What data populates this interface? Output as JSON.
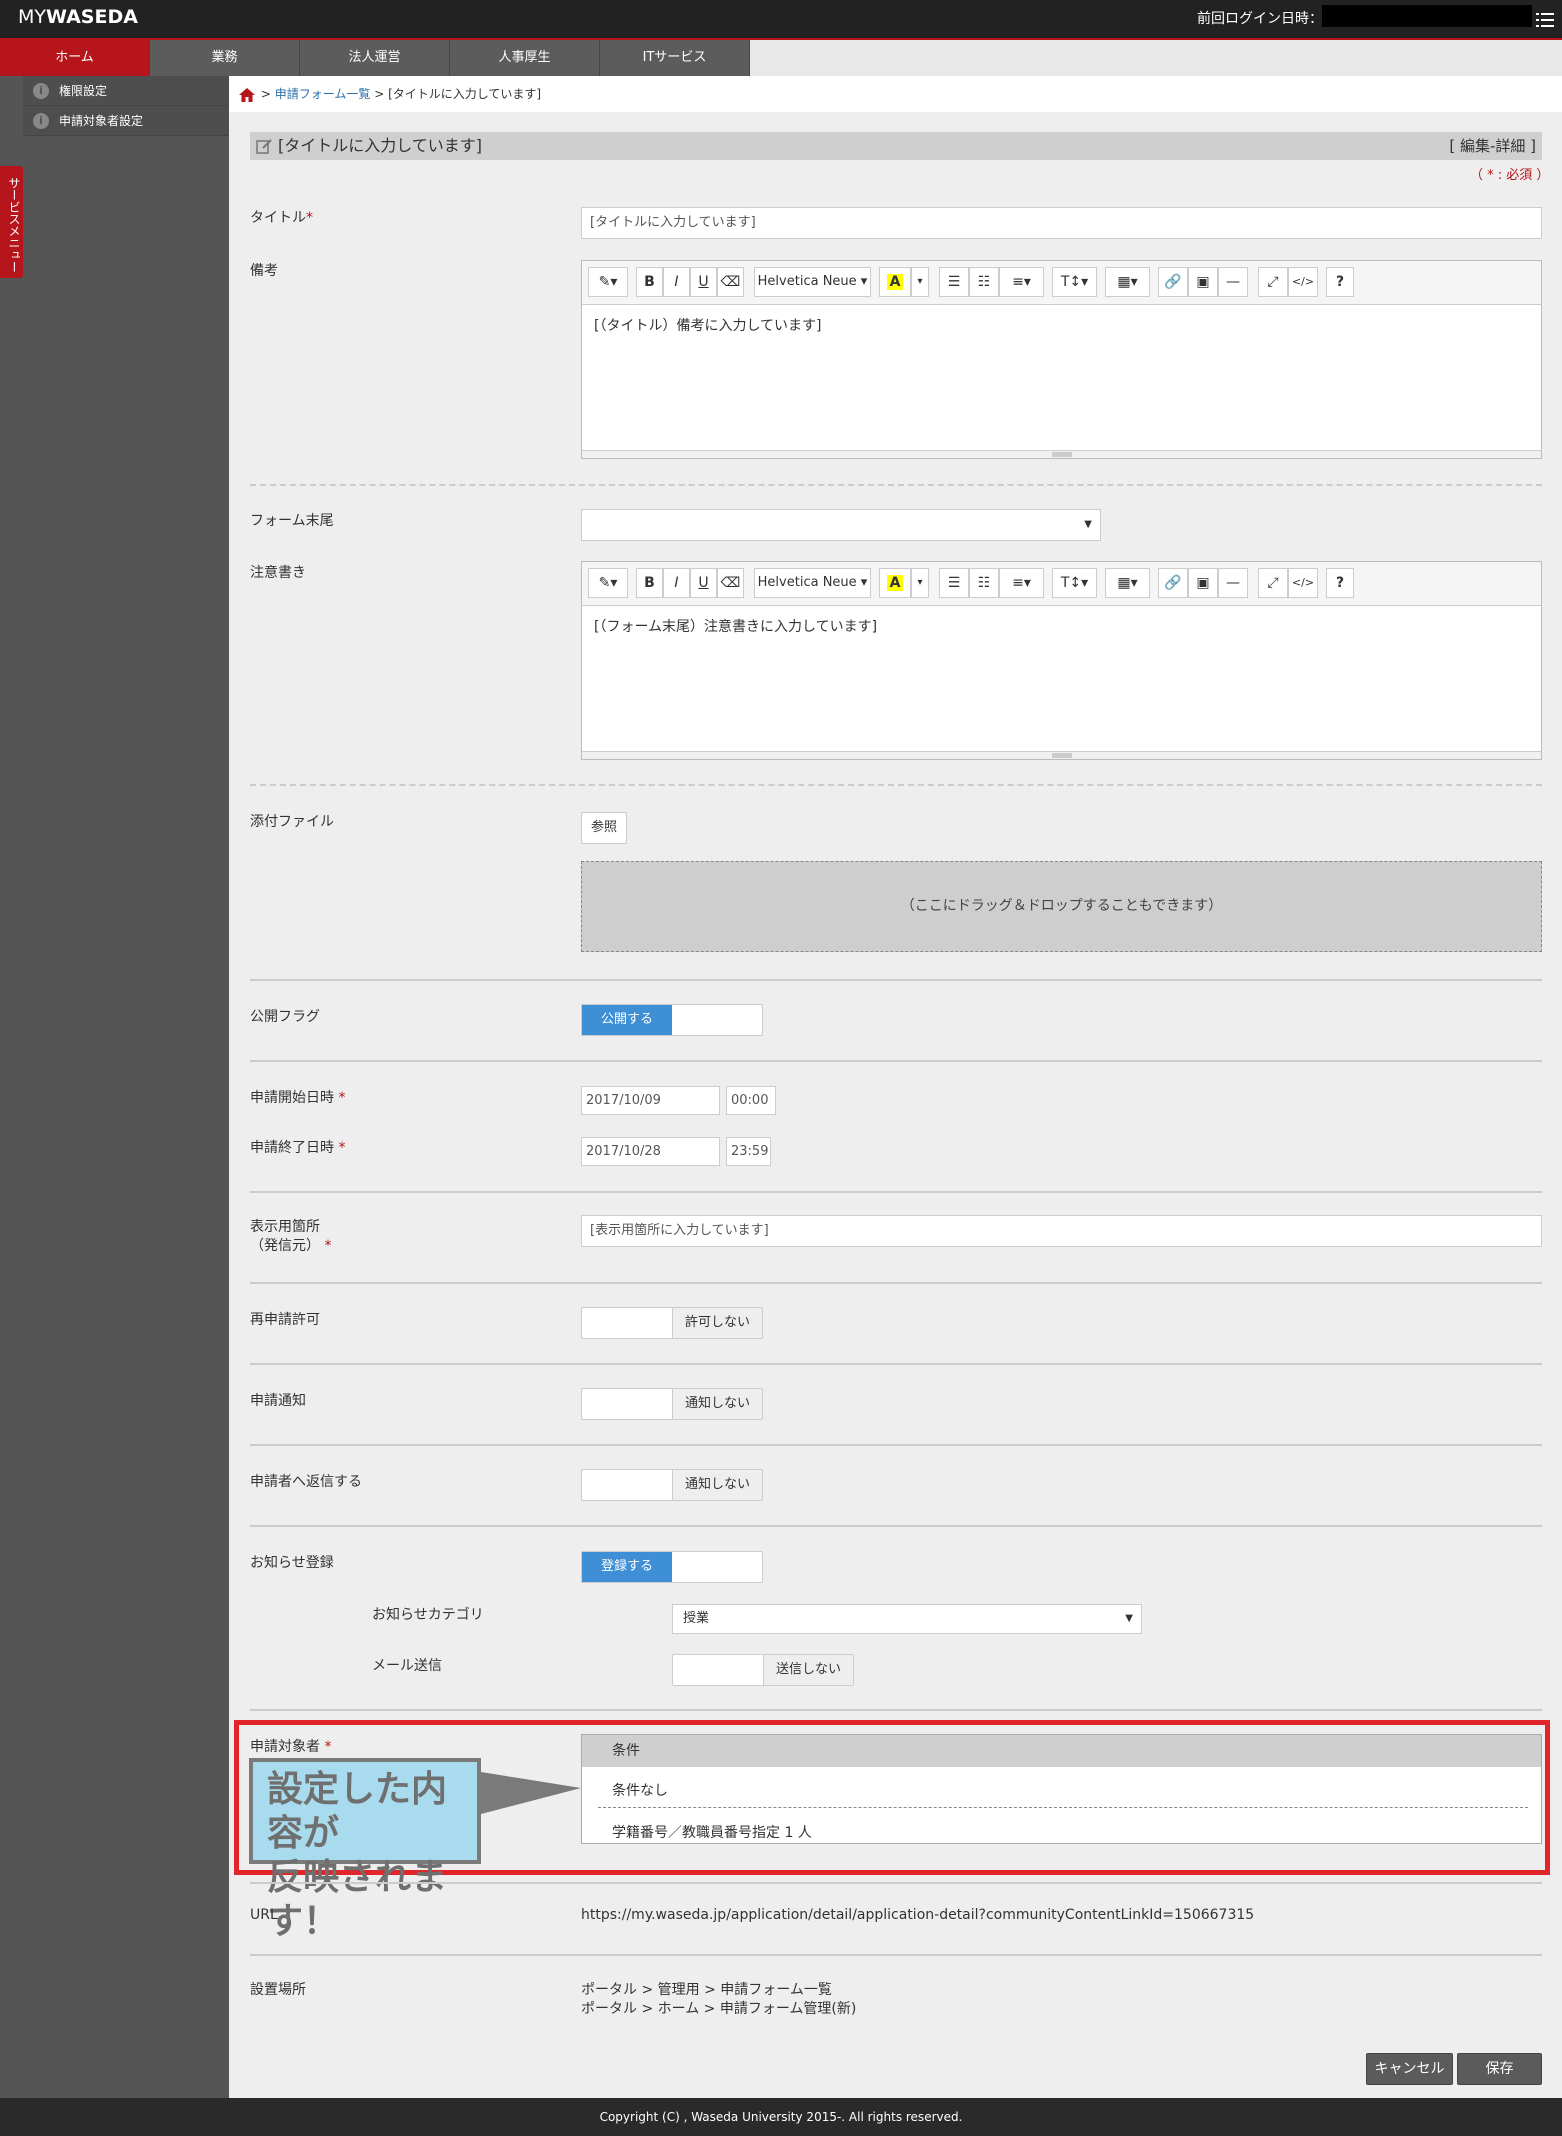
{
  "header": {
    "logo_my": "MY",
    "logo_waseda": "WASEDA",
    "last_login_label": "前回ログイン日時："
  },
  "nav": {
    "tabs": [
      {
        "label": "ホーム",
        "active": true
      },
      {
        "label": "業務"
      },
      {
        "label": "法人運営"
      },
      {
        "label": "人事厚生"
      },
      {
        "label": "ITサービス"
      }
    ]
  },
  "sidebar": {
    "service_menu": "サービスメニュー",
    "items": [
      {
        "label": "権限設定"
      },
      {
        "label": "申請対象者設定"
      }
    ]
  },
  "breadcrumb": {
    "sep1": ">",
    "link": "申請フォーム一覧",
    "sep2": ">",
    "current": "[タイトルに入力しています]"
  },
  "form": {
    "title_bar": "[タイトルに入力しています]",
    "edit_detail": "[ 編集-詳細 ]",
    "required_note": "（ * : 必須 ）",
    "title": {
      "label": "タイトル",
      "value": "[タイトルに入力しています]"
    },
    "remarks": {
      "label": "備考",
      "body": "[（タイトル）備考に入力しています]"
    },
    "form_footer": {
      "label": "フォーム末尾",
      "value": ""
    },
    "notice": {
      "label": "注意書き",
      "body": "[（フォーム末尾）注意書きに入力しています]"
    },
    "attachment": {
      "label": "添付ファイル",
      "browse": "参照",
      "dropzone": "（ここにドラッグ＆ドロップすることもできます）"
    },
    "publish": {
      "label": "公開フラグ",
      "on": "公開する"
    },
    "start": {
      "label": "申請開始日時",
      "date": "2017/10/09",
      "time": "00:00"
    },
    "end": {
      "label": "申請終了日時",
      "date": "2017/10/28",
      "time": "23:59"
    },
    "display": {
      "label_1": "表示用箇所",
      "label_2": "（発信元）",
      "value": "[表示用箇所に入力しています]"
    },
    "reapply": {
      "label": "再申請許可",
      "off": "許可しない"
    },
    "notify": {
      "label": "申請通知",
      "off": "通知しない"
    },
    "reply": {
      "label": "申請者へ返信する",
      "off": "通知しない"
    },
    "news": {
      "label": "お知らせ登録",
      "on": "登録する"
    },
    "news_category": {
      "label": "お知らせカテゴリ",
      "value": "授業"
    },
    "mail": {
      "label": "メール送信",
      "off": "送信しない"
    },
    "target": {
      "label": "申請対象者",
      "col_header": "条件",
      "row1": "条件なし",
      "row2": "学籍番号／教職員番号指定 1 人",
      "callout_line1": "設定した内容が",
      "callout_line2": "反映されます！"
    },
    "url": {
      "label": "URL",
      "value": "https://my.waseda.jp/application/detail/application-detail?communityContentLinkId=150667315"
    },
    "location": {
      "label": "設置場所",
      "line1": "ポータル > 管理用 > 申請フォーム一覧",
      "line2": "ポータル > ホーム > 申請フォーム管理(新)"
    },
    "req_mark": "*",
    "editor_font": "Helvetica Neue",
    "cancel": "キャンセル",
    "save": "保存"
  },
  "footer": {
    "copyright": "Copyright (C) , Waseda University 2015-. All rights reserved."
  },
  "colors": {
    "brand_red": "#b5151b",
    "toggle_blue": "#3f8fd6",
    "highlight_red": "#e2242b",
    "callout_blue": "#a9dbee"
  }
}
